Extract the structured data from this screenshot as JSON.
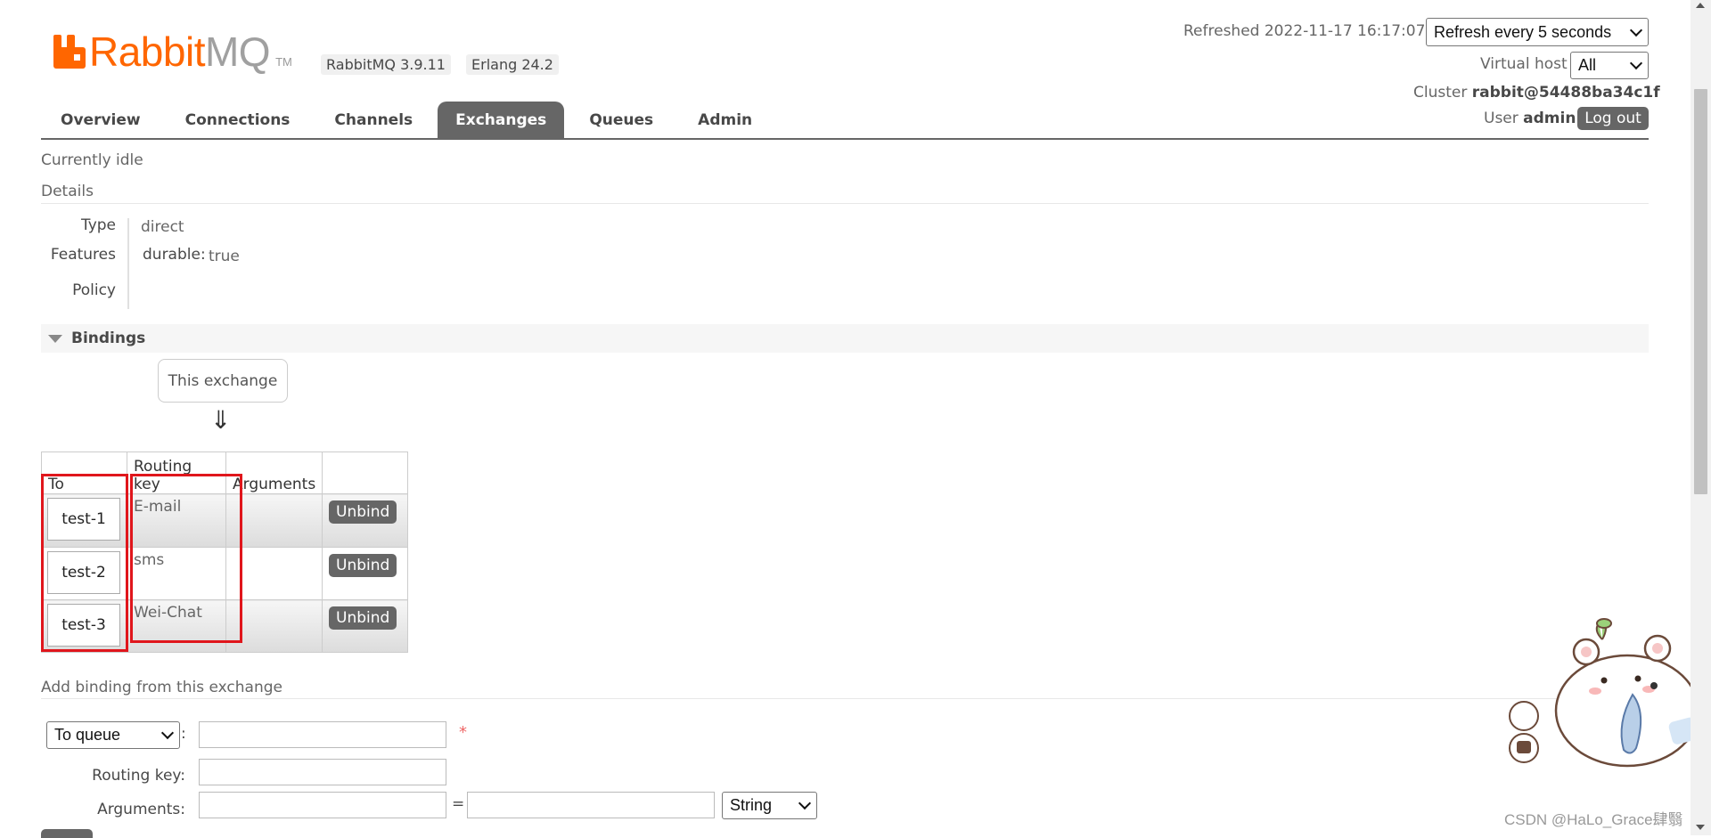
{
  "header": {
    "logo_rabbit": "Rabbit",
    "logo_mq": "MQ",
    "logo_tm": "TM",
    "version_rabbitmq": "RabbitMQ 3.9.11",
    "version_erlang": "Erlang 24.2",
    "refreshed_label": "Refreshed 2022-11-17 16:17:07",
    "refresh_select": "Refresh every 5 seconds",
    "vhost_label": "Virtual host",
    "vhost_select": "All",
    "cluster_label": "Cluster",
    "cluster_value": "rabbit@54488ba34c1f",
    "user_label": "User",
    "user_value": "admin",
    "logout": "Log out"
  },
  "tabs": [
    {
      "label": "Overview"
    },
    {
      "label": "Connections"
    },
    {
      "label": "Channels"
    },
    {
      "label": "Exchanges",
      "active": true
    },
    {
      "label": "Queues"
    },
    {
      "label": "Admin"
    }
  ],
  "status": "Currently idle",
  "details": {
    "title": "Details",
    "type_label": "Type",
    "type_value": "direct",
    "features_label": "Features",
    "durable_key": "durable:",
    "durable_value": "true",
    "policy_label": "Policy"
  },
  "bindings": {
    "title": "Bindings",
    "this_exchange": "This exchange",
    "arrow": "⇓",
    "columns": [
      "To",
      "Routing key",
      "Arguments",
      ""
    ],
    "rows": [
      {
        "to": "test-1",
        "routing_key": "E-mail",
        "arguments": "",
        "action": "Unbind"
      },
      {
        "to": "test-2",
        "routing_key": "sms",
        "arguments": "",
        "action": "Unbind"
      },
      {
        "to": "test-3",
        "routing_key": "Wei-Chat",
        "arguments": "",
        "action": "Unbind"
      }
    ]
  },
  "add_binding": {
    "title": "Add binding from this exchange",
    "destination_select": "To queue",
    "colon": ":",
    "required_star": "*",
    "routing_key_label": "Routing key:",
    "arguments_label": "Arguments:",
    "equals": "=",
    "type_select": "String"
  },
  "watermark": "CSDN @HaLo_Grace肆翳",
  "colors": {
    "brand_orange": "#ff6600",
    "tab_active": "#666666",
    "highlight_red": "#e0161c"
  }
}
